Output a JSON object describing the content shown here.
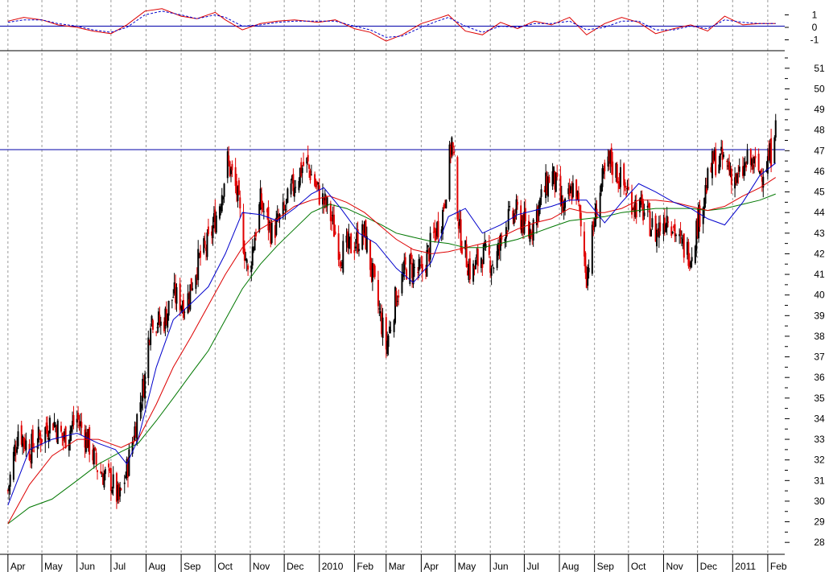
{
  "colors": {
    "background": "#ffffff",
    "grid": "#9a9a9a",
    "up_bar": "#000000",
    "down_bar": "#e00000",
    "ma_fast": "#0000cc",
    "ma_mid": "#dd0000",
    "ma_slow": "#007700",
    "resistance": "#0000aa",
    "divider": "#000000"
  },
  "chart_data": [
    {
      "type": "line",
      "panel": "oscillator",
      "ylim": [
        -2,
        2
      ],
      "y_ticks": [
        {
          "value": 1,
          "label": "1"
        },
        {
          "value": 0,
          "label": "0"
        },
        {
          "value": -1,
          "label": "-1"
        }
      ],
      "zero_line": 0.1,
      "series": [
        {
          "name": "",
          "style": "solid",
          "color": "#dd0000",
          "x": [
            "2009-04-01",
            "2009-04-15",
            "2009-05-01",
            "2009-05-15",
            "2009-06-01",
            "2009-06-15",
            "2009-07-01",
            "2009-07-15",
            "2009-07-31",
            "2009-08-15",
            "2009-09-01",
            "2009-09-15",
            "2009-10-01",
            "2009-10-10",
            "2009-10-25",
            "2009-11-10",
            "2009-11-25",
            "2009-12-10",
            "2009-12-31",
            "2010-01-15",
            "2010-02-01",
            "2010-02-15",
            "2010-03-01",
            "2010-03-15",
            "2010-04-01",
            "2010-04-15",
            "2010-04-25",
            "2010-05-10",
            "2010-05-25",
            "2010-06-10",
            "2010-06-25",
            "2010-07-10",
            "2010-07-25",
            "2010-08-10",
            "2010-08-25",
            "2010-09-10",
            "2010-09-25",
            "2010-10-10",
            "2010-10-25",
            "2010-11-10",
            "2010-11-25",
            "2010-12-10",
            "2010-12-25",
            "2011-01-10",
            "2011-01-25",
            "2011-02-08"
          ],
          "y": [
            0.5,
            0.8,
            0.6,
            0.2,
            0.0,
            -0.3,
            -0.5,
            0.2,
            1.3,
            1.5,
            0.9,
            0.7,
            1.2,
            0.6,
            -0.2,
            0.3,
            0.5,
            0.6,
            0.4,
            0.6,
            -0.1,
            -0.4,
            -1.1,
            -0.6,
            0.3,
            0.7,
            1.0,
            -0.3,
            -0.6,
            0.4,
            -0.1,
            0.5,
            0.2,
            0.8,
            -0.6,
            0.3,
            0.8,
            0.4,
            -0.5,
            -0.1,
            0.2,
            -0.3,
            0.9,
            0.2,
            0.3,
            0.3
          ]
        },
        {
          "name": "",
          "style": "dashed",
          "color": "#0000cc",
          "x": [
            "2009-04-01",
            "2009-04-15",
            "2009-05-01",
            "2009-05-15",
            "2009-06-01",
            "2009-06-15",
            "2009-07-01",
            "2009-07-15",
            "2009-07-31",
            "2009-08-15",
            "2009-09-01",
            "2009-09-15",
            "2009-10-01",
            "2009-10-10",
            "2009-10-25",
            "2009-11-10",
            "2009-11-25",
            "2009-12-10",
            "2009-12-31",
            "2010-01-15",
            "2010-02-01",
            "2010-02-15",
            "2010-03-01",
            "2010-03-15",
            "2010-04-01",
            "2010-04-15",
            "2010-04-25",
            "2010-05-10",
            "2010-05-25",
            "2010-06-10",
            "2010-06-25",
            "2010-07-10",
            "2010-07-25",
            "2010-08-10",
            "2010-08-25",
            "2010-09-10",
            "2010-09-25",
            "2010-10-10",
            "2010-10-25",
            "2010-11-10",
            "2010-11-25",
            "2010-12-10",
            "2010-12-25",
            "2011-01-10",
            "2011-01-25",
            "2011-02-08"
          ],
          "y": [
            0.4,
            0.6,
            0.6,
            0.3,
            0.1,
            -0.2,
            -0.4,
            0.0,
            1.0,
            1.3,
            1.0,
            0.7,
            1.0,
            0.8,
            0.1,
            0.2,
            0.4,
            0.5,
            0.5,
            0.5,
            0.1,
            -0.2,
            -0.8,
            -0.7,
            0.0,
            0.5,
            0.8,
            0.1,
            -0.4,
            0.1,
            0.0,
            0.3,
            0.3,
            0.5,
            -0.2,
            0.0,
            0.5,
            0.5,
            -0.2,
            -0.2,
            0.1,
            -0.1,
            0.6,
            0.4,
            0.3,
            0.3
          ]
        }
      ]
    },
    {
      "type": "candlestick",
      "panel": "price",
      "ylim": [
        27.5,
        51.5
      ],
      "y_ticks": [
        {
          "value": 28,
          "label": "28"
        },
        {
          "value": 29,
          "label": "29"
        },
        {
          "value": 30,
          "label": "30"
        },
        {
          "value": 31,
          "label": "31"
        },
        {
          "value": 32,
          "label": "32"
        },
        {
          "value": 33,
          "label": "33"
        },
        {
          "value": 34,
          "label": "34"
        },
        {
          "value": 35,
          "label": "35"
        },
        {
          "value": 36,
          "label": "36"
        },
        {
          "value": 37,
          "label": "37"
        },
        {
          "value": 38,
          "label": "38"
        },
        {
          "value": 39,
          "label": "39"
        },
        {
          "value": 40,
          "label": "40"
        },
        {
          "value": 41,
          "label": "41"
        },
        {
          "value": 42,
          "label": "42"
        },
        {
          "value": 43,
          "label": "43"
        },
        {
          "value": 44,
          "label": "44"
        },
        {
          "value": 45,
          "label": "45"
        },
        {
          "value": 46,
          "label": "46"
        },
        {
          "value": 47,
          "label": "47"
        },
        {
          "value": 48,
          "label": "48"
        },
        {
          "value": 49,
          "label": "49"
        },
        {
          "value": 50,
          "label": "50"
        },
        {
          "value": 51,
          "label": "51"
        }
      ],
      "resistance_level": 47.05,
      "x_labels": [
        {
          "date": "2009-04-01",
          "label": "Apr"
        },
        {
          "date": "2009-05-01",
          "label": "May"
        },
        {
          "date": "2009-06-01",
          "label": "Jun"
        },
        {
          "date": "2009-07-01",
          "label": "Jul"
        },
        {
          "date": "2009-08-01",
          "label": "Aug"
        },
        {
          "date": "2009-09-01",
          "label": "Sep"
        },
        {
          "date": "2009-10-01",
          "label": "Oct"
        },
        {
          "date": "2009-11-01",
          "label": "Nov"
        },
        {
          "date": "2009-12-01",
          "label": "Dec"
        },
        {
          "date": "2010-01-01",
          "label": "2010"
        },
        {
          "date": "2010-02-01",
          "label": "Feb"
        },
        {
          "date": "2010-03-01",
          "label": "Mar"
        },
        {
          "date": "2010-04-01",
          "label": "Apr"
        },
        {
          "date": "2010-05-01",
          "label": "May"
        },
        {
          "date": "2010-06-01",
          "label": "Jun"
        },
        {
          "date": "2010-07-01",
          "label": "Jul"
        },
        {
          "date": "2010-08-01",
          "label": "Aug"
        },
        {
          "date": "2010-09-01",
          "label": "Sep"
        },
        {
          "date": "2010-10-01",
          "label": "Oct"
        },
        {
          "date": "2010-11-01",
          "label": "Nov"
        },
        {
          "date": "2010-12-01",
          "label": "Dec"
        },
        {
          "date": "2011-01-01",
          "label": "2011"
        },
        {
          "date": "2011-02-01",
          "label": "Feb"
        }
      ],
      "close_path": {
        "x": [
          "2009-04-01",
          "2009-04-10",
          "2009-04-20",
          "2009-05-01",
          "2009-05-10",
          "2009-05-20",
          "2009-06-01",
          "2009-06-10",
          "2009-06-20",
          "2009-07-01",
          "2009-07-08",
          "2009-07-15",
          "2009-07-22",
          "2009-07-31",
          "2009-08-05",
          "2009-08-15",
          "2009-08-25",
          "2009-09-05",
          "2009-09-15",
          "2009-09-25",
          "2009-10-05",
          "2009-10-12",
          "2009-10-20",
          "2009-10-30",
          "2009-11-10",
          "2009-11-20",
          "2009-12-01",
          "2009-12-10",
          "2009-12-20",
          "2009-12-31",
          "2010-01-10",
          "2010-01-20",
          "2010-02-01",
          "2010-02-10",
          "2010-02-20",
          "2010-03-01",
          "2010-03-10",
          "2010-03-20",
          "2010-04-01",
          "2010-04-10",
          "2010-04-20",
          "2010-04-28",
          "2010-05-05",
          "2010-05-15",
          "2010-05-25",
          "2010-06-05",
          "2010-06-15",
          "2010-06-25",
          "2010-07-05",
          "2010-07-15",
          "2010-07-25",
          "2010-08-05",
          "2010-08-15",
          "2010-08-25",
          "2010-09-05",
          "2010-09-15",
          "2010-09-25",
          "2010-10-05",
          "2010-10-15",
          "2010-10-25",
          "2010-11-05",
          "2010-11-15",
          "2010-11-25",
          "2010-12-05",
          "2010-12-15",
          "2010-12-25",
          "2011-01-05",
          "2011-01-15",
          "2011-01-25",
          "2011-02-01",
          "2011-02-05",
          "2011-02-08"
        ],
        "y": [
          30.5,
          33.5,
          32.5,
          33.2,
          34.0,
          33.0,
          34.0,
          33.0,
          31.5,
          31.0,
          30.0,
          31.5,
          33.5,
          36.0,
          39.0,
          38.5,
          40.0,
          39.5,
          41.5,
          42.5,
          44.5,
          46.5,
          45.0,
          41.0,
          44.5,
          43.0,
          44.0,
          45.5,
          46.5,
          45.0,
          44.0,
          42.0,
          42.5,
          43.0,
          40.0,
          37.5,
          40.0,
          41.5,
          41.0,
          42.5,
          44.0,
          47.5,
          43.0,
          41.0,
          42.0,
          41.5,
          43.5,
          44.0,
          43.0,
          44.5,
          46.0,
          44.0,
          45.5,
          41.0,
          45.0,
          46.5,
          45.5,
          44.5,
          44.0,
          43.0,
          44.0,
          42.5,
          42.0,
          44.5,
          46.5,
          46.5,
          45.5,
          46.5,
          46.0,
          46.5,
          47.0,
          49.0
        ]
      },
      "ma_fast": {
        "x": [
          "2009-04-01",
          "2009-04-20",
          "2009-05-10",
          "2009-06-01",
          "2009-06-20",
          "2009-07-05",
          "2009-07-15",
          "2009-07-25",
          "2009-08-10",
          "2009-08-25",
          "2009-09-10",
          "2009-09-25",
          "2009-10-10",
          "2009-10-25",
          "2009-11-10",
          "2009-11-25",
          "2009-12-10",
          "2009-12-25",
          "2010-01-05",
          "2010-01-20",
          "2010-02-05",
          "2010-02-20",
          "2010-03-10",
          "2010-03-25",
          "2010-04-10",
          "2010-04-25",
          "2010-05-10",
          "2010-05-25",
          "2010-06-10",
          "2010-06-25",
          "2010-07-10",
          "2010-07-25",
          "2010-08-10",
          "2010-08-25",
          "2010-09-10",
          "2010-09-25",
          "2010-10-10",
          "2010-10-25",
          "2010-11-10",
          "2010-11-25",
          "2010-12-10",
          "2010-12-25",
          "2011-01-10",
          "2011-01-25",
          "2011-02-08"
        ],
        "y": [
          29.8,
          32.5,
          33.0,
          33.3,
          32.8,
          32.5,
          31.8,
          33.0,
          36.5,
          38.8,
          39.6,
          40.4,
          42.0,
          44.0,
          43.9,
          43.6,
          44.2,
          44.9,
          45.2,
          44.2,
          43.0,
          42.5,
          41.3,
          40.6,
          41.6,
          43.8,
          44.2,
          43.0,
          43.4,
          43.9,
          44.1,
          44.3,
          44.6,
          44.6,
          43.5,
          44.5,
          45.4,
          45.0,
          44.5,
          44.2,
          43.7,
          43.4,
          44.5,
          45.8,
          46.4
        ]
      },
      "ma_mid": {
        "x": [
          "2009-04-01",
          "2009-04-20",
          "2009-05-10",
          "2009-06-01",
          "2009-06-20",
          "2009-07-10",
          "2009-07-25",
          "2009-08-10",
          "2009-08-25",
          "2009-09-10",
          "2009-09-25",
          "2009-10-10",
          "2009-10-25",
          "2009-11-10",
          "2009-11-25",
          "2009-12-10",
          "2009-12-25",
          "2010-01-10",
          "2010-01-25",
          "2010-02-10",
          "2010-02-25",
          "2010-03-10",
          "2010-03-25",
          "2010-04-10",
          "2010-04-25",
          "2010-05-10",
          "2010-05-25",
          "2010-06-10",
          "2010-06-25",
          "2010-07-10",
          "2010-07-25",
          "2010-08-10",
          "2010-08-25",
          "2010-09-10",
          "2010-09-25",
          "2010-10-10",
          "2010-10-25",
          "2010-11-10",
          "2010-11-25",
          "2010-12-10",
          "2010-12-25",
          "2011-01-10",
          "2011-01-25",
          "2011-02-08"
        ],
        "y": [
          28.9,
          30.8,
          32.2,
          33.0,
          33.0,
          32.6,
          33.0,
          34.7,
          36.5,
          38.0,
          39.5,
          41.0,
          42.3,
          43.2,
          43.7,
          44.3,
          44.6,
          44.8,
          44.5,
          44.0,
          43.3,
          42.7,
          42.2,
          42.0,
          42.1,
          42.3,
          42.5,
          42.8,
          43.2,
          43.5,
          43.7,
          44.2,
          44.0,
          44.0,
          44.2,
          44.6,
          44.6,
          44.5,
          44.3,
          44.1,
          44.3,
          44.8,
          45.2,
          45.7
        ]
      },
      "ma_slow": {
        "x": [
          "2009-04-01",
          "2009-04-20",
          "2009-05-10",
          "2009-06-01",
          "2009-06-20",
          "2009-07-10",
          "2009-07-25",
          "2009-08-10",
          "2009-08-25",
          "2009-09-10",
          "2009-09-25",
          "2009-10-10",
          "2009-10-25",
          "2009-11-10",
          "2009-11-25",
          "2009-12-10",
          "2009-12-25",
          "2010-01-10",
          "2010-01-25",
          "2010-02-10",
          "2010-02-25",
          "2010-03-10",
          "2010-03-25",
          "2010-04-10",
          "2010-04-25",
          "2010-05-10",
          "2010-05-25",
          "2010-06-10",
          "2010-06-25",
          "2010-07-10",
          "2010-07-25",
          "2010-08-10",
          "2010-08-25",
          "2010-09-10",
          "2010-09-25",
          "2010-10-10",
          "2010-10-25",
          "2010-11-10",
          "2010-11-25",
          "2010-12-10",
          "2010-12-25",
          "2011-01-10",
          "2011-01-25",
          "2011-02-08"
        ],
        "y": [
          28.9,
          29.7,
          30.1,
          31.0,
          31.8,
          32.4,
          32.8,
          33.9,
          35.0,
          36.2,
          37.3,
          38.8,
          40.3,
          41.5,
          42.4,
          43.2,
          44.0,
          44.4,
          44.2,
          43.8,
          43.4,
          43.0,
          42.8,
          42.6,
          42.5,
          42.3,
          42.3,
          42.5,
          42.7,
          43.0,
          43.3,
          43.6,
          43.7,
          43.8,
          44.0,
          44.1,
          44.2,
          44.2,
          44.2,
          44.1,
          44.2,
          44.4,
          44.6,
          44.9
        ]
      }
    }
  ]
}
